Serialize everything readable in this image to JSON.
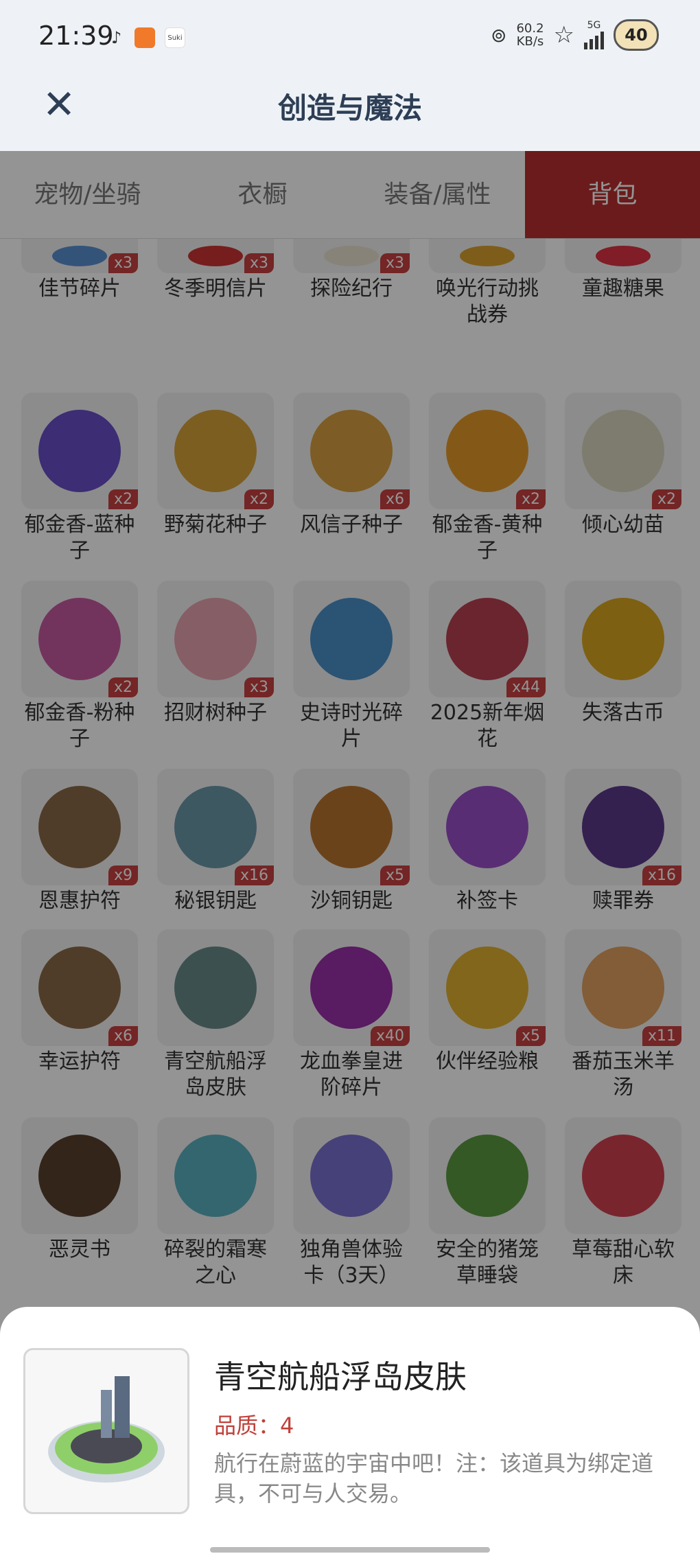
{
  "status": {
    "time": "21:39",
    "net_speed_value": "60.2",
    "net_speed_unit": "KB/s",
    "network": "5G",
    "battery": "40",
    "app_label": "Suki"
  },
  "header": {
    "title": "创造与魔法",
    "close_icon": "close-icon"
  },
  "tabs": [
    {
      "label": "宠物/坐骑",
      "active": false
    },
    {
      "label": "衣橱",
      "active": false
    },
    {
      "label": "装备/属性",
      "active": false
    },
    {
      "label": "背包",
      "active": true
    }
  ],
  "accent_color": "#b83030",
  "items": [
    {
      "label": "佳节碎片",
      "count": "x3",
      "color": "#5a8fd0"
    },
    {
      "label": "冬季明信片",
      "count": "x3",
      "color": "#c33"
    },
    {
      "label": "探险纪行",
      "count": "x3",
      "color": "#e8e2d0"
    },
    {
      "label": "唤光行动挑战券",
      "count": "",
      "color": "#d9a030"
    },
    {
      "label": "童趣糖果",
      "count": "",
      "color": "#d34"
    },
    {
      "label": "郁金香-蓝种子",
      "count": "x2",
      "color": "#6a4fc8"
    },
    {
      "label": "野菊花种子",
      "count": "x2",
      "color": "#d6a23a"
    },
    {
      "label": "风信子种子",
      "count": "x6",
      "color": "#d8a040"
    },
    {
      "label": "郁金香-黄种子",
      "count": "x2",
      "color": "#e49a2a"
    },
    {
      "label": "倾心幼苗",
      "count": "x2",
      "color": "#d9d6bf"
    },
    {
      "label": "郁金香-粉种子",
      "count": "x2",
      "color": "#c55aa0"
    },
    {
      "label": "招财树种子",
      "count": "x3",
      "color": "#e7a3b0"
    },
    {
      "label": "史诗时光碎片",
      "count": "",
      "color": "#4a8fc8"
    },
    {
      "label": "2025新年烟花",
      "count": "x44",
      "color": "#b84050"
    },
    {
      "label": "失落古币",
      "count": "",
      "color": "#d9a520"
    },
    {
      "label": "恩惠护符",
      "count": "x9",
      "color": "#8a6a48"
    },
    {
      "label": "秘银钥匙",
      "count": "x16",
      "color": "#6a98a8"
    },
    {
      "label": "沙铜钥匙",
      "count": "x5",
      "color": "#b8742f"
    },
    {
      "label": "补签卡",
      "count": "",
      "color": "#9a4fc8"
    },
    {
      "label": "赎罪券",
      "count": "x16",
      "color": "#5a3a8a"
    },
    {
      "label": "幸运护符",
      "count": "x6",
      "color": "#8a6a48"
    },
    {
      "label": "青空航船浮岛皮肤",
      "count": "",
      "color": "#6a8a8a"
    },
    {
      "label": "龙血拳皇进阶碎片",
      "count": "x40",
      "color": "#9a30a8"
    },
    {
      "label": "伙伴经验粮",
      "count": "x5",
      "color": "#e0b030"
    },
    {
      "label": "番茄玉米羊汤",
      "count": "x11",
      "color": "#e0a060"
    },
    {
      "label": "恶灵书",
      "count": "",
      "color": "#5a4030"
    },
    {
      "label": "碎裂的霜寒之心",
      "count": "",
      "color": "#5ab0c0"
    },
    {
      "label": "独角兽体验卡（3天）",
      "count": "",
      "color": "#7a70d0"
    },
    {
      "label": "安全的猪笼草睡袋",
      "count": "",
      "color": "#5a9a40"
    },
    {
      "label": "草莓甜心软床",
      "count": "",
      "color": "#d04050"
    }
  ],
  "detail": {
    "title": "青空航船浮岛皮肤",
    "quality": "品质：4",
    "description": "航行在蔚蓝的宇宙中吧！注：该道具为绑定道具，不可与人交易。"
  }
}
